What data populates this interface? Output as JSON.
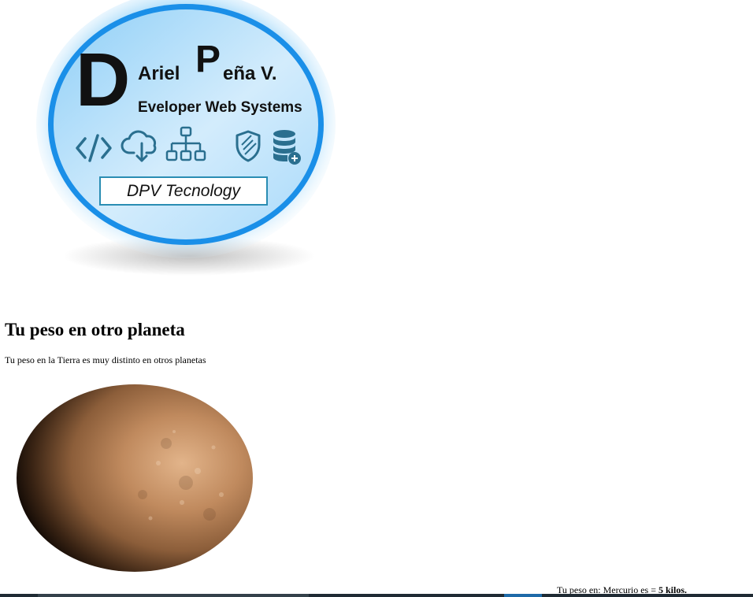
{
  "logo": {
    "big_letter_1": "D",
    "line1": "Ariel",
    "big_letter_2": "P",
    "line1b": "eña V.",
    "line2": "Eveloper Web Systems",
    "badge": "DPV Tecnology",
    "icons": [
      "code-icon",
      "cloud-download-icon",
      "sitemap-icon",
      "shield-icon",
      "database-add-icon"
    ],
    "colors": {
      "ring": "#1a8fe8",
      "fill": "#bfe3fb",
      "glow": "#4fb6f5",
      "icon": "#2a6f8f"
    }
  },
  "page": {
    "title": "Tu peso en otro planeta",
    "subtitle": "Tu peso en la Tierra es muy distinto en otros planetas"
  },
  "planet": {
    "name": "Mercurio",
    "colors": {
      "light": "#d9a87e",
      "mid": "#a87650",
      "dark": "#2a1a10"
    }
  },
  "result": {
    "prefix": "Tu peso en: ",
    "planet": "Mercurio",
    "middle": " es = ",
    "value": "5 kilos."
  }
}
